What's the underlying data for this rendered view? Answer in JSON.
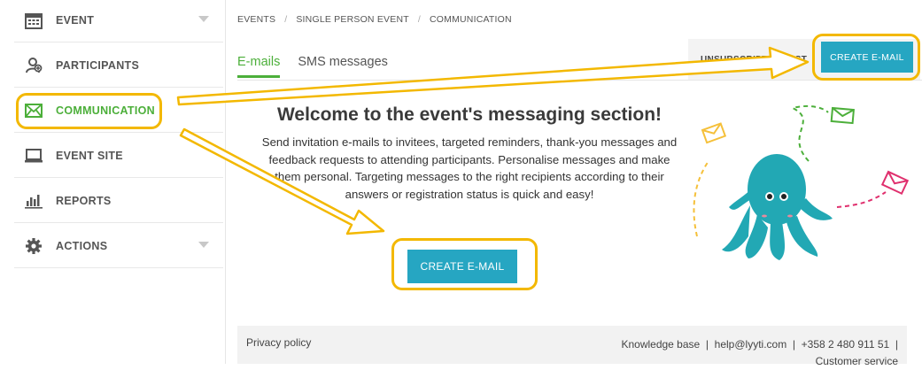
{
  "sidebar": {
    "items": [
      {
        "label": "EVENT",
        "icon": "calendar-icon"
      },
      {
        "label": "PARTICIPANTS",
        "icon": "participants-icon"
      },
      {
        "label": "COMMUNICATION",
        "icon": "envelope-icon"
      },
      {
        "label": "EVENT SITE",
        "icon": "laptop-icon"
      },
      {
        "label": "REPORTS",
        "icon": "bar-chart-icon"
      },
      {
        "label": "ACTIONS",
        "icon": "gear-icon"
      }
    ]
  },
  "breadcrumb": [
    "EVENTS",
    "SINGLE PERSON EVENT",
    "COMMUNICATION"
  ],
  "tabs": [
    "E-mails",
    "SMS messages"
  ],
  "unsubscription_label": "UNSUBSCRIPTION LIST",
  "create_email_label": "CREATE E-MAIL",
  "welcome": {
    "title": "Welcome to the event's messaging section!",
    "description": "Send invitation e-mails to invitees, targeted reminders, thank-you messages and feedback requests to attending participants. Personalise messages and make them personal. Targeting messages to the right recipients according to their answers or registration status is quick and easy!"
  },
  "footer": {
    "privacy": "Privacy policy",
    "knowledge": "Knowledge base",
    "email": "help@lyyti.com",
    "phone": "+358 2 480 911 51",
    "service": "Customer service"
  },
  "colors": {
    "accent_green": "#4caf3a",
    "button_blue": "#26a6c2",
    "highlight_yellow": "#f3b800",
    "mascot_teal": "#22a8b4"
  }
}
